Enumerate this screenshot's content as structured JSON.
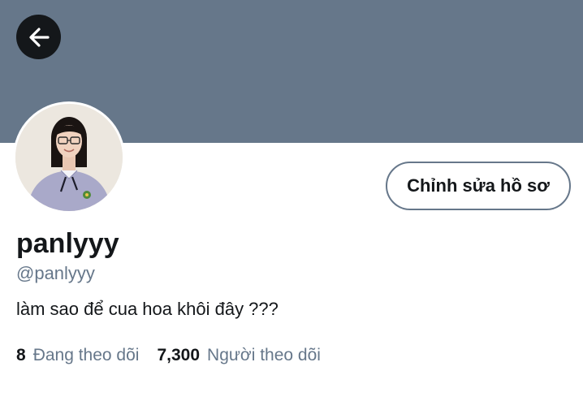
{
  "header": {
    "banner_color": "#66778a",
    "back_icon": "arrow-left-icon"
  },
  "profile": {
    "display_name": "panlyyy",
    "handle": "@panlyyy",
    "bio": "làm sao để cua hoa khôi đây ???",
    "edit_button_label": "Chỉnh sửa hồ sơ"
  },
  "stats": {
    "following_count": "8",
    "following_label": "Đang theo dõi",
    "followers_count": "7,300",
    "followers_label": "Người theo dõi"
  },
  "colors": {
    "text_primary": "#14171a",
    "text_secondary": "#66778a"
  }
}
